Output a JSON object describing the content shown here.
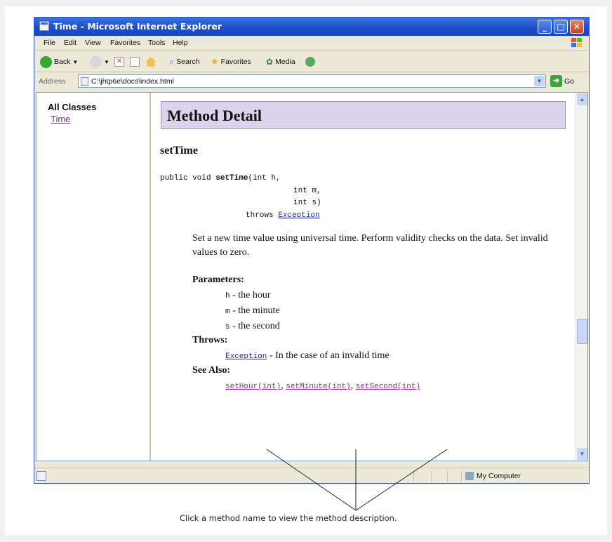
{
  "window": {
    "title": "Time - Microsoft Internet Explorer"
  },
  "menu": [
    "File",
    "Edit",
    "View",
    "Favorites",
    "Tools",
    "Help"
  ],
  "toolbar": {
    "back": "Back",
    "search": "Search",
    "favorites": "Favorites",
    "media": "Media"
  },
  "address": {
    "label": "Address",
    "value": "C:\\jhtp6e\\docs\\index.html",
    "go": "Go"
  },
  "left_frame": {
    "heading": "All Classes",
    "link": "Time"
  },
  "doc": {
    "section_title": "Method Detail",
    "method_name": "setTime",
    "signature": {
      "line1_prefix": "public void ",
      "line1_name": "setTime",
      "line1_params": "(int h,",
      "line2": "int m,",
      "line3": "int s)",
      "throws_kw": "throws ",
      "throws_link": "Exception"
    },
    "description": "Set a new time value using universal time. Perform validity checks on the data. Set invalid values to zero.",
    "parameters_label": "Parameters:",
    "params": [
      {
        "name": "h",
        "desc": " - the hour"
      },
      {
        "name": "m",
        "desc": " - the minute"
      },
      {
        "name": "s",
        "desc": " - the second"
      }
    ],
    "throws_label": "Throws:",
    "throws_link": "Exception",
    "throws_desc": " - In the case of an invalid time",
    "see_also_label": "See Also:",
    "see_also": [
      "setHour(int)",
      "setMinute(int)",
      "setSecond(int)"
    ]
  },
  "status": {
    "zone": "My Computer"
  },
  "caption": "Click a method name to view the method description."
}
